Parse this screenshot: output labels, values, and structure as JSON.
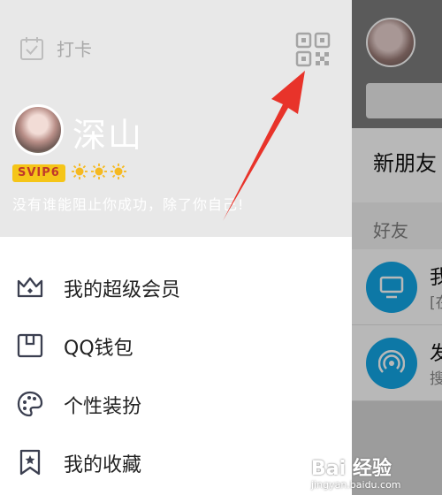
{
  "drawer": {
    "checkin_label": "打卡",
    "profile": {
      "nickname": "深山",
      "badge": "SVIP6",
      "signature": "没有谁能阻止你成功，除了你自己!"
    },
    "menu": [
      {
        "label": "我的超级会员",
        "icon": "crown-icon"
      },
      {
        "label": "QQ钱包",
        "icon": "wallet-icon"
      },
      {
        "label": "个性装扮",
        "icon": "palette-icon"
      },
      {
        "label": "我的收藏",
        "icon": "bookmark-star-icon"
      }
    ]
  },
  "background": {
    "new_friends": "新朋友",
    "group": "好友",
    "rows": [
      {
        "title": "我",
        "sub": "[在"
      },
      {
        "title": "发",
        "sub": "搜"
      }
    ]
  },
  "watermark": {
    "logo": "Bai 经验",
    "sub": "jingyan.baidu.com"
  },
  "colors": {
    "header_bg": "#e8e8e8",
    "badge_bg": "#f5c518",
    "accent_blue": "#12a7e6",
    "arrow_red": "#e8332a"
  }
}
